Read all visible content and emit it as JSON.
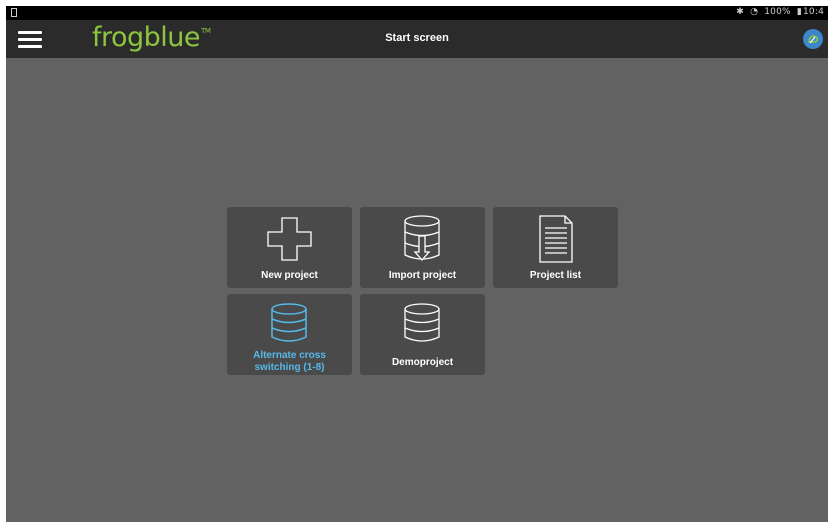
{
  "status": {
    "battery_text": "100%",
    "time": "10:4",
    "bluetooth_icon": "bluetooth-icon",
    "wifi_icon": "wifi-icon"
  },
  "header": {
    "logo": "frogblue",
    "logo_tm": "TM",
    "title": "Start screen",
    "menu_icon": "hamburger-icon",
    "cloud_icon": "cloud-sync-icon"
  },
  "tiles": [
    {
      "label": "New project",
      "icon": "plus-icon",
      "color": "#ffffff"
    },
    {
      "label": "Import project",
      "icon": "database-import-icon",
      "color": "#ffffff"
    },
    {
      "label": "Project list",
      "icon": "document-list-icon",
      "color": "#ffffff"
    },
    {
      "label": "Alternate cross switching (1-8)",
      "icon": "database-icon",
      "color": "#56b9e8",
      "line1": "Alternate cross",
      "line2": "switching (1-8)"
    },
    {
      "label": "Demoproject",
      "icon": "database-icon",
      "color": "#ffffff"
    }
  ],
  "colors": {
    "accent_green": "#8cc63f",
    "highlight_blue": "#56b9e8",
    "background": "#626262",
    "appbar": "#2b2b2b"
  }
}
